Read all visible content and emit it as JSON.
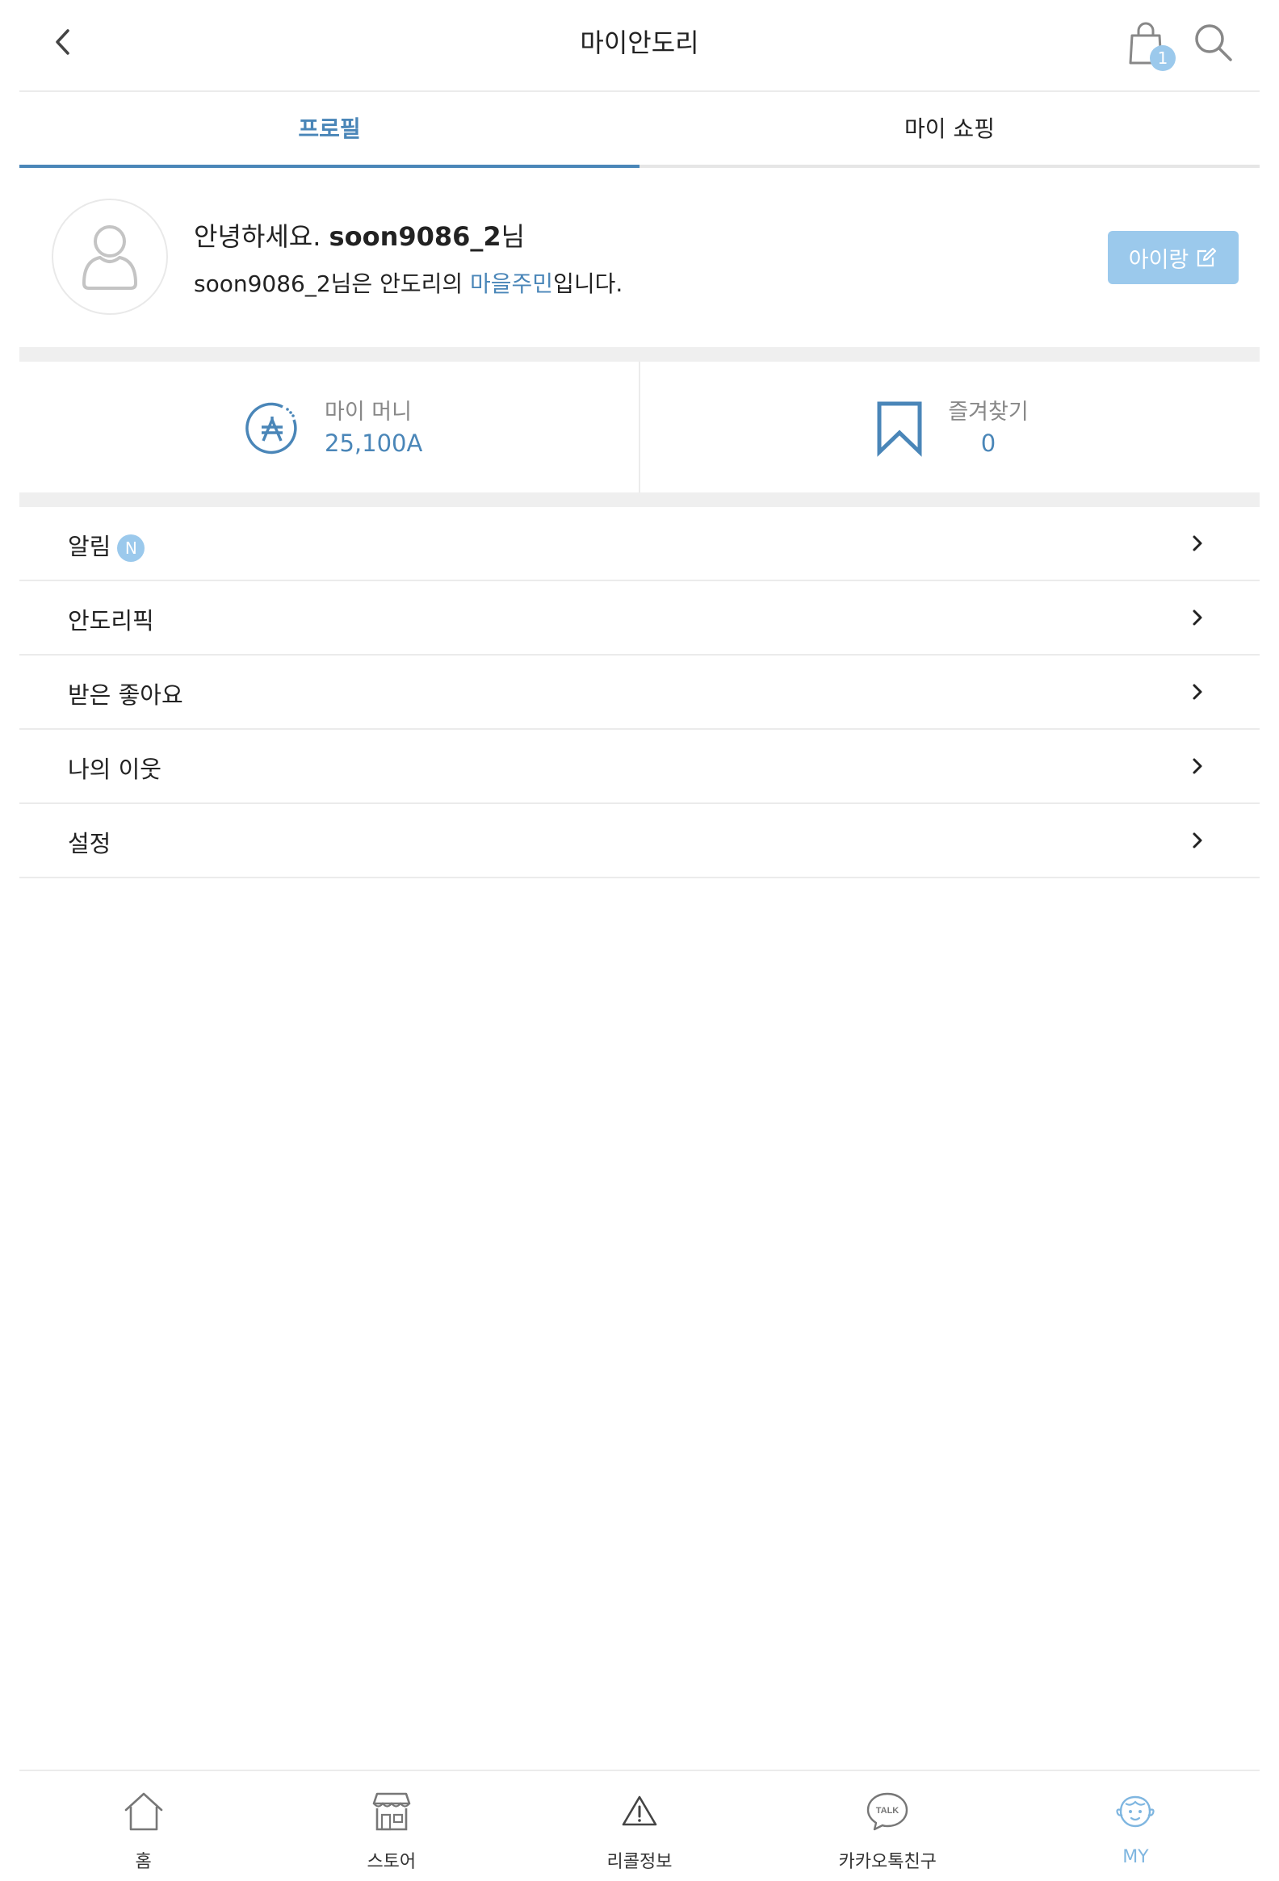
{
  "header": {
    "title": "마이안도리",
    "cart_count": "1"
  },
  "tabs": [
    {
      "label": "프로필",
      "active": true
    },
    {
      "label": "마이 쇼핑",
      "active": false
    }
  ],
  "profile": {
    "greeting_prefix": "안녕하세요. ",
    "username": "soon9086_2",
    "greeting_suffix": "님",
    "membership_prefix": "soon9086_2님은 안도리의 ",
    "membership_level": "마을주민",
    "membership_suffix": "입니다.",
    "edit_button_label": "아이랑"
  },
  "stats": {
    "money": {
      "label": "마이 머니",
      "value": "25,100A"
    },
    "favorites": {
      "label": "즐겨찾기",
      "value": "0"
    }
  },
  "menu": [
    {
      "label": "알림",
      "badge": "N"
    },
    {
      "label": "안도리픽"
    },
    {
      "label": "받은 좋아요"
    },
    {
      "label": "나의 이웃"
    },
    {
      "label": "설정"
    }
  ],
  "bottom_nav": [
    {
      "label": "홈",
      "icon": "home-icon"
    },
    {
      "label": "스토어",
      "icon": "store-icon"
    },
    {
      "label": "리콜정보",
      "icon": "warning-icon"
    },
    {
      "label": "카카오톡친구",
      "icon": "kakaotalk-icon"
    },
    {
      "label": "MY",
      "icon": "baby-face-icon",
      "active": true
    }
  ],
  "colors": {
    "accent": "#4a86b8",
    "accent_light": "#9bc9ec",
    "divider": "#efefef"
  }
}
